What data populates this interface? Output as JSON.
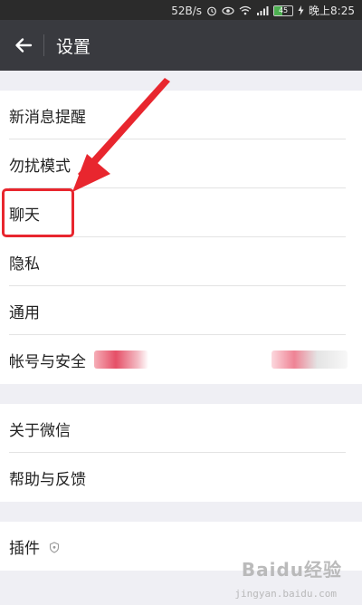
{
  "status_bar": {
    "speed": "52B/s",
    "battery_level": "45",
    "time": "晚上8:25",
    "icons": [
      "alarm-icon",
      "eye-icon",
      "wifi-icon",
      "signal-icon",
      "battery-icon",
      "charging-icon"
    ]
  },
  "app_bar": {
    "title": "设置",
    "back_icon": "arrow-left-icon"
  },
  "groups": [
    {
      "items": [
        {
          "label": "新消息提醒"
        },
        {
          "label": "勿扰模式"
        },
        {
          "label": "聊天"
        },
        {
          "label": "隐私"
        },
        {
          "label": "通用"
        },
        {
          "label": "帐号与安全"
        }
      ]
    },
    {
      "items": [
        {
          "label": "关于微信"
        },
        {
          "label": "帮助与反馈"
        }
      ]
    },
    {
      "items": [
        {
          "label": "插件",
          "icon": "plugin-shield-icon"
        }
      ]
    }
  ],
  "annotation": {
    "highlight_color": "#e8262e",
    "highlight_target": "聊天"
  },
  "watermark": {
    "text": "Baidu经验",
    "subtext": "jingyan.baidu.com"
  },
  "colors": {
    "status_bar_bg": "#2b2b2b",
    "app_bar_bg": "#393a3f",
    "page_bg": "#efeff4",
    "row_bg": "#ffffff",
    "text": "#222222"
  }
}
